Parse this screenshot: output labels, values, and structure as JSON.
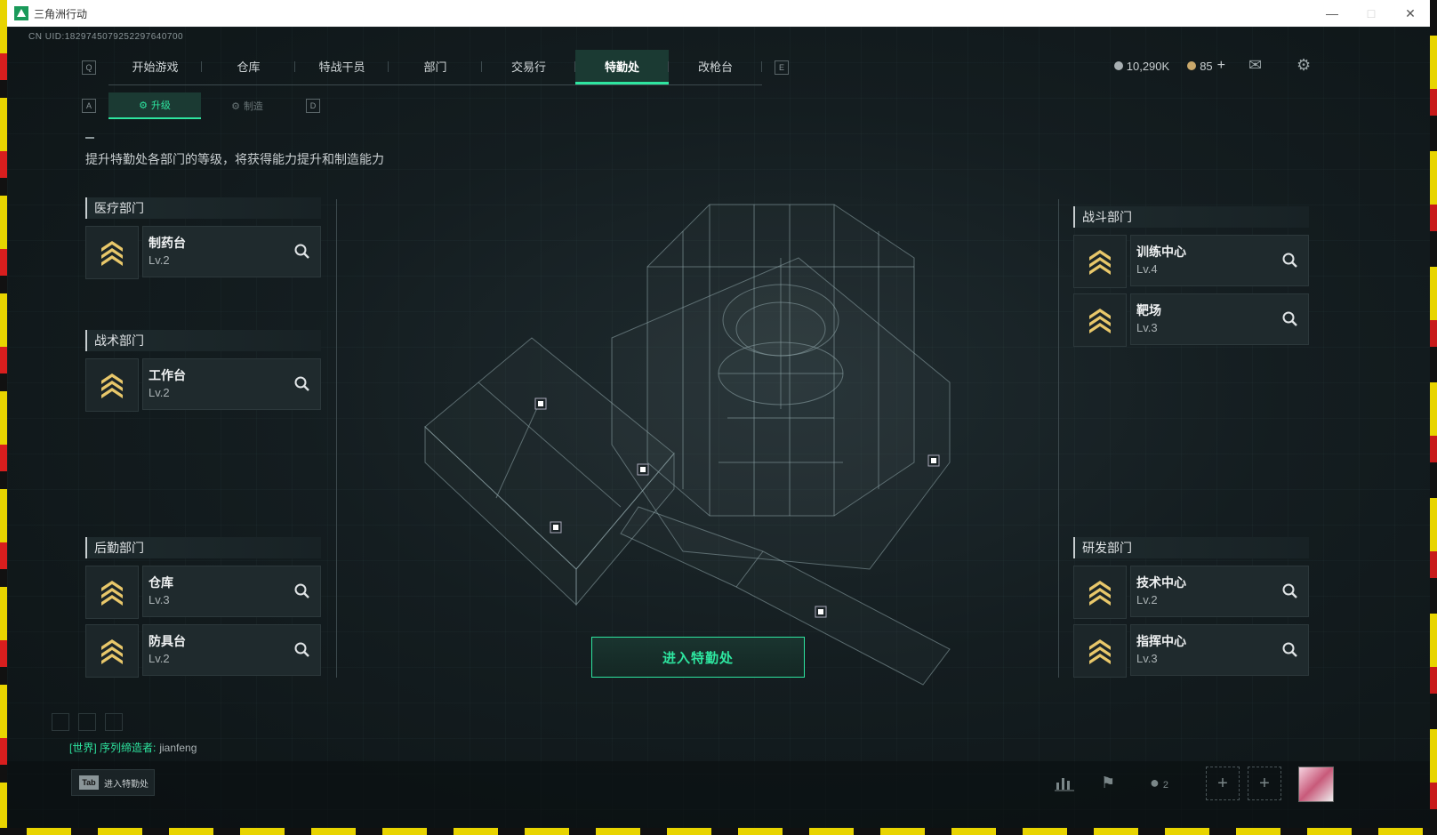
{
  "window": {
    "title": "三角洲行动"
  },
  "uid": "CN UID:1829745079252297640700",
  "topnav": {
    "left_key": "Q",
    "right_key": "E",
    "tabs": [
      {
        "label": "开始游戏"
      },
      {
        "label": "仓库"
      },
      {
        "label": "特战干员"
      },
      {
        "label": "部门"
      },
      {
        "label": "交易行"
      },
      {
        "label": "特勤处",
        "active": true
      },
      {
        "label": "改枪台"
      }
    ]
  },
  "currency": {
    "silver": "10,290K",
    "gold": "85",
    "gold_add": "+"
  },
  "subnav": {
    "left_key": "A",
    "right_key": "D",
    "tabs": [
      {
        "label": "升级",
        "active": true
      },
      {
        "label": "制造"
      }
    ]
  },
  "description": "提升特勤处各部门的等级，将获得能力提升和制造能力",
  "departments": {
    "medical": {
      "title": "医疗部门",
      "items": [
        {
          "name": "制药台",
          "level": "Lv.2"
        }
      ]
    },
    "tactical": {
      "title": "战术部门",
      "items": [
        {
          "name": "工作台",
          "level": "Lv.2"
        }
      ]
    },
    "logistics": {
      "title": "后勤部门",
      "items": [
        {
          "name": "仓库",
          "level": "Lv.3"
        },
        {
          "name": "防具台",
          "level": "Lv.2"
        }
      ]
    },
    "combat": {
      "title": "战斗部门",
      "items": [
        {
          "name": "训练中心",
          "level": "Lv.4"
        },
        {
          "name": "靶场",
          "level": "Lv.3"
        }
      ]
    },
    "research": {
      "title": "研发部门",
      "items": [
        {
          "name": "技术中心",
          "level": "Lv.2"
        },
        {
          "name": "指挥中心",
          "level": "Lv.3"
        }
      ]
    }
  },
  "enter_button": "进入特勤处",
  "chat": {
    "channel": "[世界] 序列缔造者:",
    "user": "jianfeng"
  },
  "bottom": {
    "tab_key": "Tab",
    "tab_label": "进入特勤处",
    "friends_count": "2"
  },
  "colors": {
    "accent": "#2ee6a0",
    "background": "#10181b",
    "chevron": "#e8c76a"
  },
  "icons": [
    "search-icon",
    "mail-icon",
    "settings-icon",
    "chart-icon",
    "flag-icon",
    "friends-icon",
    "rank-chevron-icon"
  ]
}
